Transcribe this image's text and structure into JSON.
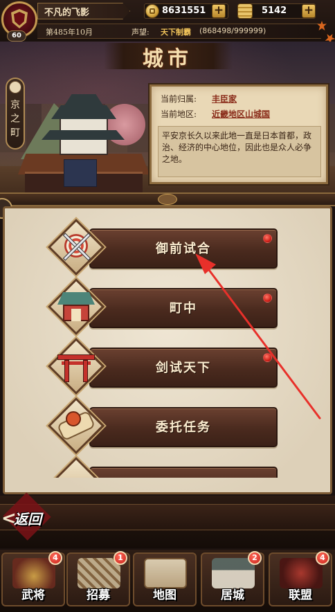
{
  "header": {
    "player_name": "不凡的飞影",
    "level": "60",
    "gold": "8631551",
    "rice": "5142",
    "plus_symbol": "+",
    "date": "第485年10月",
    "reputation_label": "声望:",
    "reputation_rank": "天下制霸",
    "reputation_value": "(868498/999999)"
  },
  "page": {
    "title": "城市",
    "town_name": [
      "京",
      "之",
      "町"
    ]
  },
  "info": {
    "belong_label": "当前归属:",
    "belong_value": "丰臣家",
    "area_label": "当前地区:",
    "area_value": "近畿地区山城国",
    "description": "平安京长久以来此地一直是日本首都，政治、经济的中心地位，因此也是众人必争之地。"
  },
  "menu": {
    "items": [
      {
        "label": "御前试合",
        "has_dot": true,
        "icon": "crossed-swords-target-icon"
      },
      {
        "label": "町中",
        "has_dot": true,
        "icon": "townhouse-icon"
      },
      {
        "label": "剑试天下",
        "has_dot": true,
        "icon": "torii-gate-icon"
      },
      {
        "label": "委托任务",
        "has_dot": false,
        "icon": "scroll-icon"
      }
    ]
  },
  "return": {
    "arrow": "<",
    "label": "返回"
  },
  "nav": {
    "items": [
      {
        "label": "武将",
        "badge": "4",
        "icon": "samurai-helmet-icon"
      },
      {
        "label": "招募",
        "badge": "1",
        "icon": "recruit-banner-icon"
      },
      {
        "label": "地图",
        "badge": "",
        "icon": "map-scroll-icon"
      },
      {
        "label": "居城",
        "badge": "2",
        "icon": "castle-icon"
      },
      {
        "label": "联盟",
        "badge": "4",
        "icon": "alliance-emblem-icon"
      }
    ]
  },
  "colors": {
    "accent_red": "#d1221a",
    "wood_dark": "#3b2117",
    "parchment": "#e9d8b6",
    "annotation_arrow": "#e8302a"
  }
}
